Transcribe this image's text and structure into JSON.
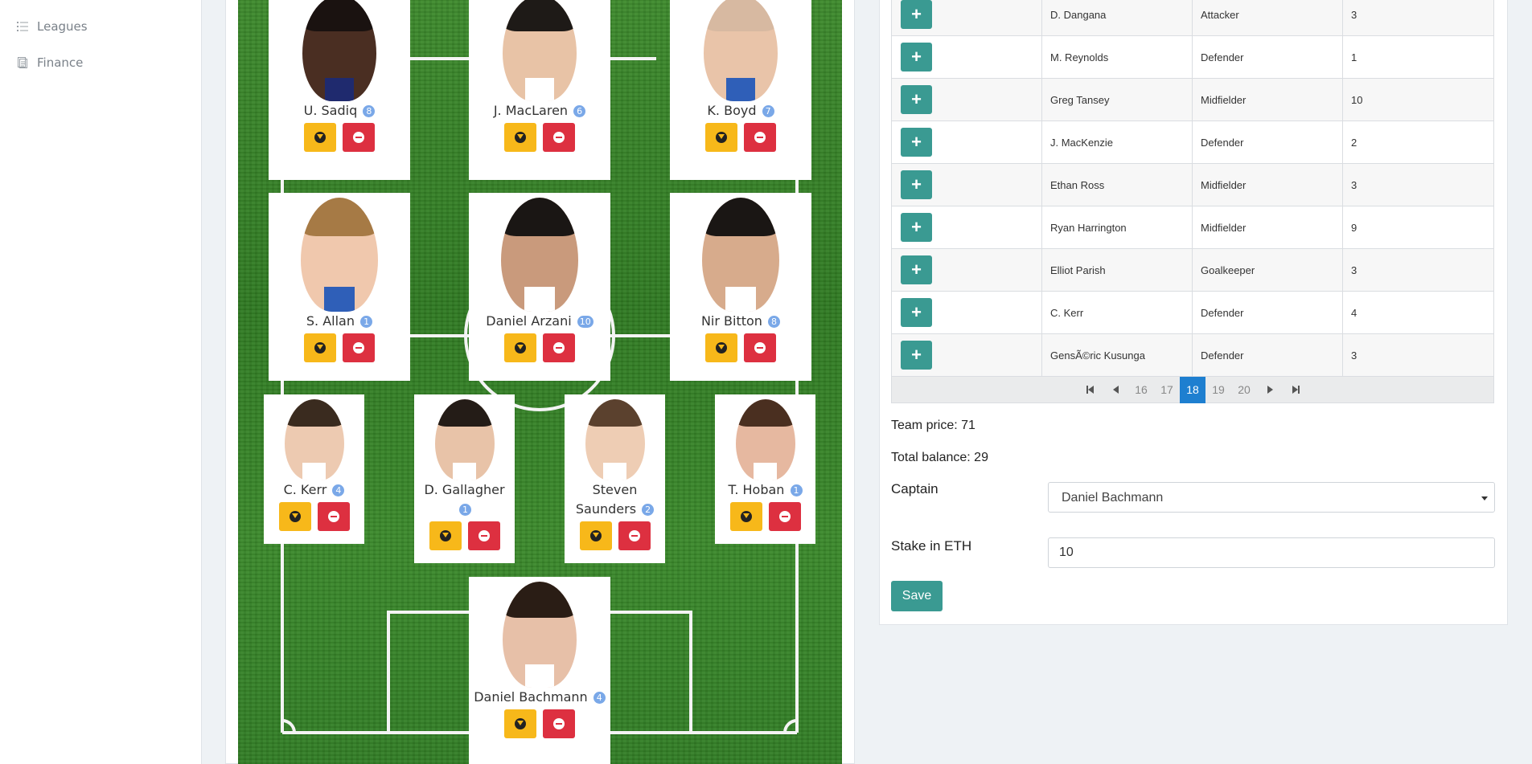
{
  "sidebar": {
    "items": [
      {
        "label": "Leagues",
        "icon": "list-icon"
      },
      {
        "label": "Finance",
        "icon": "document-icon"
      }
    ]
  },
  "pitch": {
    "players": [
      {
        "name": "U. Sadiq",
        "badge": "8",
        "skin": "#4a2e22",
        "hair": "#1a1210",
        "shirt": "#1f2a6e"
      },
      {
        "name": "J. MacLaren",
        "badge": "6",
        "skin": "#e8c3a6",
        "hair": "#1e1a17",
        "shirt": "#ffffff"
      },
      {
        "name": "K. Boyd",
        "badge": "7",
        "skin": "#e9c4a9",
        "hair": "#d7b9a1",
        "shirt": "#2f5fb8"
      },
      {
        "name": "S. Allan",
        "badge": "1",
        "skin": "#f0c8ad",
        "hair": "#a67a45",
        "shirt": "#2f5fb8"
      },
      {
        "name": "Daniel Arzani",
        "badge": "10",
        "skin": "#c99a7c",
        "hair": "#1a1614",
        "shirt": "#ffffff"
      },
      {
        "name": "Nir Bitton",
        "badge": "8",
        "skin": "#d7ab8c",
        "hair": "#1a1614",
        "shirt": "#ffffff"
      },
      {
        "name": "C. Kerr",
        "badge": "4",
        "skin": "#edcab1",
        "hair": "#3a2b1f",
        "shirt": "#ffffff"
      },
      {
        "name": "D. Gallagher",
        "badge": "1",
        "skin": "#e8c3a8",
        "hair": "#241c17",
        "shirt": "#ffffff"
      },
      {
        "name": "Steven Saunders",
        "badge": "2",
        "skin": "#eecdb4",
        "hair": "#5b412e",
        "shirt": "#ffffff"
      },
      {
        "name": "T. Hoban",
        "badge": "1",
        "skin": "#e6b8a0",
        "hair": "#4a2f20",
        "shirt": "#ffffff"
      },
      {
        "name": "Daniel Bachmann",
        "badge": "4",
        "skin": "#e7c0a8",
        "hair": "#2a1d15",
        "shirt": "#ffffff"
      }
    ]
  },
  "table": {
    "add_label": "+",
    "rows": [
      {
        "name": "D. Dangana",
        "position": "Attacker",
        "price": "3"
      },
      {
        "name": "M. Reynolds",
        "position": "Defender",
        "price": "1"
      },
      {
        "name": "Greg Tansey",
        "position": "Midfielder",
        "price": "10"
      },
      {
        "name": "J. MacKenzie",
        "position": "Defender",
        "price": "2"
      },
      {
        "name": "Ethan Ross",
        "position": "Midfielder",
        "price": "3"
      },
      {
        "name": "Ryan Harrington",
        "position": "Midfielder",
        "price": "9"
      },
      {
        "name": "Elliot Parish",
        "position": "Goalkeeper",
        "price": "3"
      },
      {
        "name": "C. Kerr",
        "position": "Defender",
        "price": "4"
      },
      {
        "name": "GensÃ©ric Kusunga",
        "position": "Defender",
        "price": "3"
      }
    ]
  },
  "pager": {
    "pages": [
      "16",
      "17",
      "18",
      "19",
      "20"
    ],
    "active": "18"
  },
  "summary": {
    "team_price": "Team price: 71",
    "total_balance": "Total balance: 29"
  },
  "form": {
    "captain_label": "Captain",
    "captain_value": "Daniel Bachmann",
    "stake_label": "Stake in ETH",
    "stake_value": "10",
    "save_label": "Save"
  }
}
